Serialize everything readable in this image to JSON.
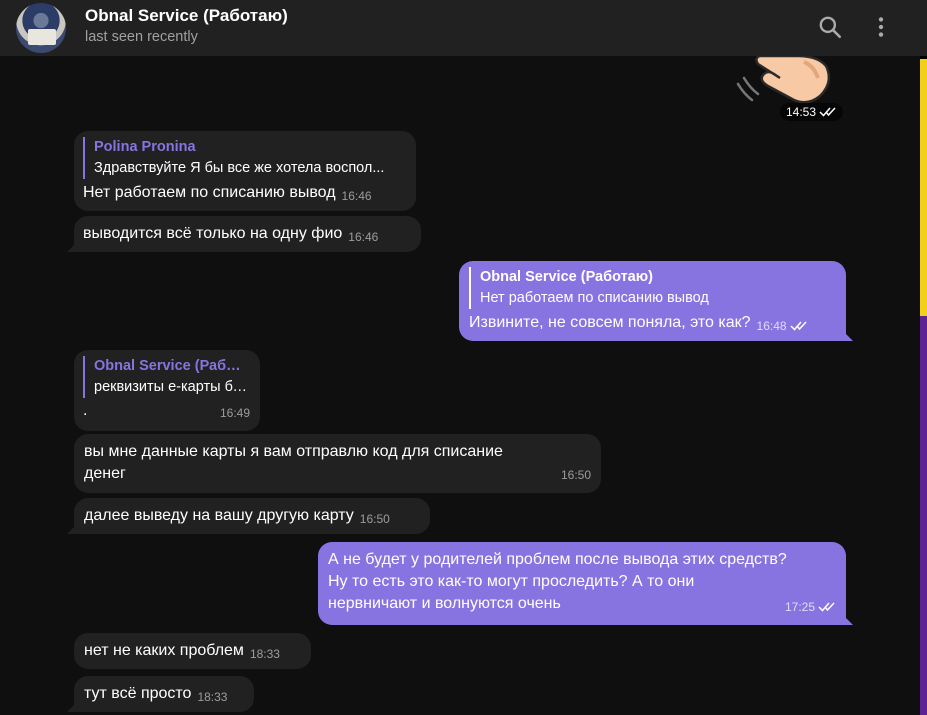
{
  "header": {
    "title": "Obnal Service (Работаю)",
    "status": "last seen recently",
    "icons": [
      "search-icon",
      "more-vertical-icon"
    ]
  },
  "messages": {
    "m0": {
      "kind": "sticker",
      "sticker": "waving-hand",
      "time": "14:53",
      "read": true
    },
    "m1": {
      "kind": "incoming",
      "reply_name": "Polina Pronina",
      "reply_text": "Здравствуйте Я бы все же хотела воспол...",
      "text": "Нет работаем по списанию вывод",
      "time": "16:46"
    },
    "m2": {
      "kind": "incoming",
      "text": "выводится всё только на одну фио",
      "time": "16:46"
    },
    "m3": {
      "kind": "outgoing",
      "reply_name": "Obnal Service (Работаю)",
      "reply_text": "Нет работаем по списанию вывод",
      "text": "Извините, не совсем поняла, это как?",
      "time": "16:48",
      "read": true
    },
    "m4": {
      "kind": "incoming",
      "reply_name": "Obnal Service (Работаю)",
      "reply_text": "реквизиты е-карты банка",
      "text": ".",
      "time": "16:49"
    },
    "m5": {
      "kind": "incoming",
      "lines": [
        "вы мне данные карты я вам отправлю код для списание",
        "денег"
      ],
      "time": "16:50"
    },
    "m6": {
      "kind": "incoming",
      "text": "далее выведу на вашу другую карту",
      "time": "16:50"
    },
    "m7": {
      "kind": "outgoing",
      "lines": [
        "А не будет у родителей проблем после вывода этих средств?",
        "Ну то есть это как-то могут проследить? А то они",
        "нервничают и волнуются очень"
      ],
      "time": "17:25",
      "read": true
    },
    "m8": {
      "kind": "incoming",
      "text": "нет не каких проблем",
      "time": "18:33"
    },
    "m9": {
      "kind": "incoming",
      "text": "тут всё просто",
      "time": "18:33"
    }
  },
  "colors": {
    "accent": "#8774e1",
    "incoming_bubble": "#212121",
    "header_bg": "#212121",
    "chat_bg": "#0f0f0f"
  }
}
